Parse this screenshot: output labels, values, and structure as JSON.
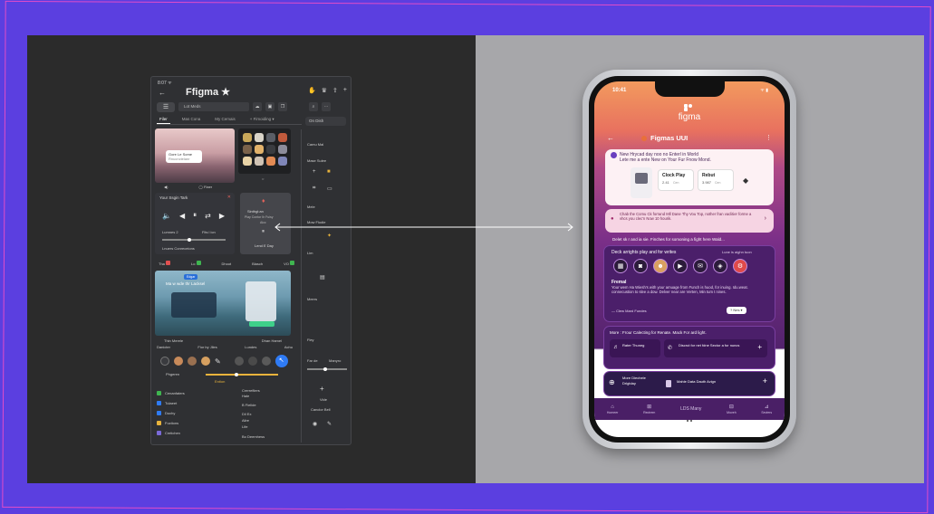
{
  "colors": {
    "background": "#5b3fe0",
    "frame_line": "#e04cc8",
    "left_panel": "#2b2b2b",
    "right_panel": "#a7a7aa",
    "accent_blue": "#2f7bf5",
    "phone_grad_top": "#f29a5e",
    "phone_grad_mid": "#b04a86",
    "phone_grad_bottom": "#53236d"
  },
  "editor": {
    "status": "8:07 ᯤ",
    "title": "Ffigma ★",
    "search": "Lot Meds",
    "tabs": [
      "Filer",
      "Mas Cona",
      "My Cemais",
      "+ Fimoiding ▾"
    ],
    "chip_right": "On Dish",
    "card1": {
      "line1": "Gore Le Some",
      "line2": "Rnucnctelanr",
      "footer_l": "◀)",
      "footer_r": "◯ Flaer"
    },
    "card2": {
      "footer": "○"
    },
    "player": {
      "title": "Your Ssgin Tark",
      "lumnes": "Lumnes 2",
      "fitsout": "Fits l icn",
      "caption": "Lnuers Conreceions"
    },
    "phone_card": {
      "title": "Sinthgl:an",
      "sub": "Play Contor Ih Fuisy",
      "sub2": "Alcc",
      "footer": "Lend E Day"
    },
    "row_labels": [
      "Tha",
      "Lo",
      "Dhoot",
      "Blasch",
      "VO"
    ],
    "landscape": {
      "tag": "Edgar",
      "title": "Ma w wde thr Lacksel",
      "left": "Thin Merele",
      "right": "Dhan Hamel"
    },
    "tool_labels": [
      "Danicter",
      "Fior by Jlles",
      "Lundes",
      "Achu"
    ],
    "list_head": "Phgeren",
    "list_head_r": "Ention",
    "list_left": [
      "Cenanfaters",
      "Tulaeet",
      "Duchy",
      "Fuctions",
      "Cmtichen"
    ],
    "list_right": [
      "Crerrefiiers",
      "Hale",
      "B Fiellde",
      "Dil Ex",
      "Ailre",
      "Life",
      "Bo Deemhess"
    ],
    "sidebar": [
      "Camu Mal",
      "Mase Sulee",
      "Mele",
      "Mow Flodie",
      "Lim",
      "Meers",
      "Fley",
      "Far de",
      "Manyro",
      "Vide",
      "Canclor Bell"
    ]
  },
  "phone": {
    "time": "10:41",
    "status_icons": "ᯤ ▮",
    "brand": "figma",
    "header_title": "Figmas UUI",
    "intro_line1": "New Hrycad day noo no Enterl in Morld",
    "intro_line2": "Lete me a ente New on Your Fur Fnow Mond.",
    "badge1_title": "Clock Play",
    "badge1_value": "2.41",
    "badge1_unit": "Cen",
    "badge2_title": "Rebut",
    "badge2_value": "3.987",
    "badge2_unit": "Cen",
    "notice": "Chab the Comu Ck forrand Mll Dane Thy Vou Top, nother fran vaclitier forme a vhcs you clec'n Now 10 hourik.",
    "section2_head": "Delet sk r and ia sie. Finches for somoning a fight here Wald...",
    "section3_title": "Deck arrights play and for writes",
    "section3_right": "Lune is aighn tuon",
    "feed_title": "Fremal",
    "feed_body": "Your wem Ha Wiesh's with your amuage from Funch is huod, for inuing. Idu.weat. connecustion to slee a dow. Delver near are Verten, Min tum t nines.",
    "feed_link": "— Clew Mard Fundes",
    "feed_btn": "? Nes ▾",
    "more_head": "More : Frour Calecting for Renate. Mack For ard light.",
    "tile1": "Rater Thuneg",
    "tile2": "Discrut for net fdne Sector a for nuncs",
    "bottom1": "More Diechele Drlgtday",
    "bottom2": "Mahle Data Dauth Avign",
    "nav": [
      "Homeer",
      "Rectrem",
      "LDS Many",
      "Moveh",
      "Seviers"
    ]
  }
}
